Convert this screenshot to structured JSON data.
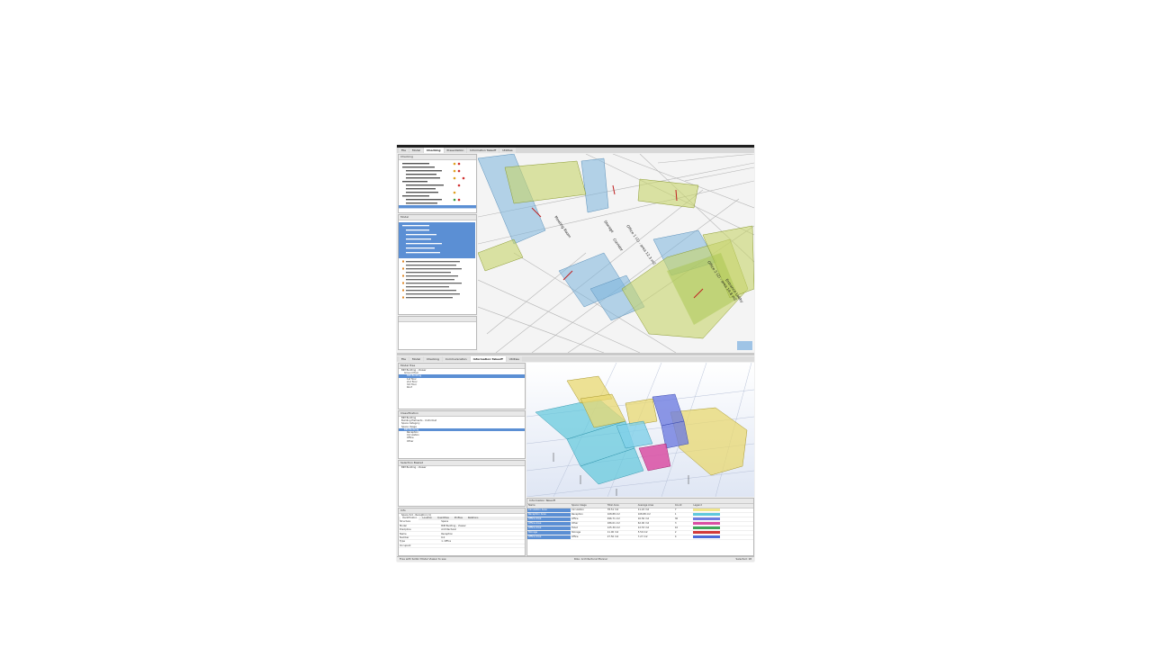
{
  "top_window": {
    "tabs": [
      "File",
      "Model",
      "Checking",
      "Presentation",
      "Information Takeoff",
      "Utilities"
    ],
    "active_tab": 2,
    "rules_panel_title": "Checking",
    "model_panel_title": "Model",
    "viewport_labels": [
      "Office 1 (1) - area 12.3 m2",
      "Storage",
      "Corridor",
      "Office 2 (2) - area 14.8 m2",
      "Entrance Lobby",
      "Meeting Room"
    ]
  },
  "bottom_window": {
    "title": "Solibri Model Checker - BIM Building - Viewer",
    "tabs": [
      "File",
      "Model",
      "Checking",
      "Communication",
      "Information Takeoff",
      "Utilities"
    ],
    "active_tab": 4,
    "model_tree": {
      "title": "Model Tree",
      "items": [
        "BIM Building - Viewer",
        "Ground floor",
        "BIM Building",
        "1st floor",
        "2nd floor",
        "3rd floor",
        "Roof"
      ]
    },
    "classification": {
      "title": "Classification",
      "items": [
        "BIM Building",
        "Building Elements - Uniformat",
        "Space Category",
        "Space Usage",
        "BIM Building",
        "Reception",
        "Circulation",
        "Office",
        "Other"
      ]
    },
    "selection_basket": {
      "title": "Selection Basket",
      "items": [
        "BIM Building - Viewer"
      ]
    },
    "info": {
      "title": "Info",
      "subtitle": "Space 6.0 - Reception (1)",
      "tabs": [
        "Identification",
        "Location",
        "Quantities",
        "Profiles",
        "Relations"
      ],
      "rows": [
        [
          "Structure",
          "Space"
        ],
        [
          "Model",
          "BIM Building - Viewer"
        ],
        [
          "Discipline",
          "Architectural"
        ],
        [
          "Name",
          "Reception"
        ],
        [
          "Number",
          "6.0"
        ],
        [
          "Type",
          "1. Office"
        ],
        [
          "Occupant",
          ""
        ]
      ]
    },
    "takeoff": {
      "title": "Information Takeoff",
      "columns": [
        "Name",
        "Space Usage",
        "Total Area",
        "Average Area",
        "Count",
        "Legend"
      ],
      "rows": [
        [
          "Circulation Area",
          "Circulation",
          "78.51 m2",
          "11.22 m2",
          "7",
          "#f0e68c"
        ],
        [
          "Reception Area",
          "Reception",
          "108.88 m2",
          "108.88 m2",
          "1",
          "#5fc8dc"
        ],
        [
          "Office Area",
          "Office",
          "496.71 m2",
          "16.56 m2",
          "30",
          "#6f7de0"
        ],
        [
          "Office Area",
          "Other",
          "186.01 m2",
          "62.00 m2",
          "3",
          "#d94fa3"
        ],
        [
          "Office Area",
          "Toilet",
          "125.30 m2",
          "12.53 m2",
          "10",
          "#3fa65a"
        ],
        [
          "Storage",
          "Storage",
          "11.00 m2",
          "5.50 m2",
          "2",
          "#d23a3a"
        ],
        [
          "Office Area",
          "Office",
          "27.50 m2",
          "7.27 m2",
          "4",
          "#4c6ad8"
        ]
      ]
    },
    "status_left": "Free with Solibri Model Viewer to see",
    "status_right": "Role: Architectural Planner",
    "status_selected": "Selected: 18"
  }
}
